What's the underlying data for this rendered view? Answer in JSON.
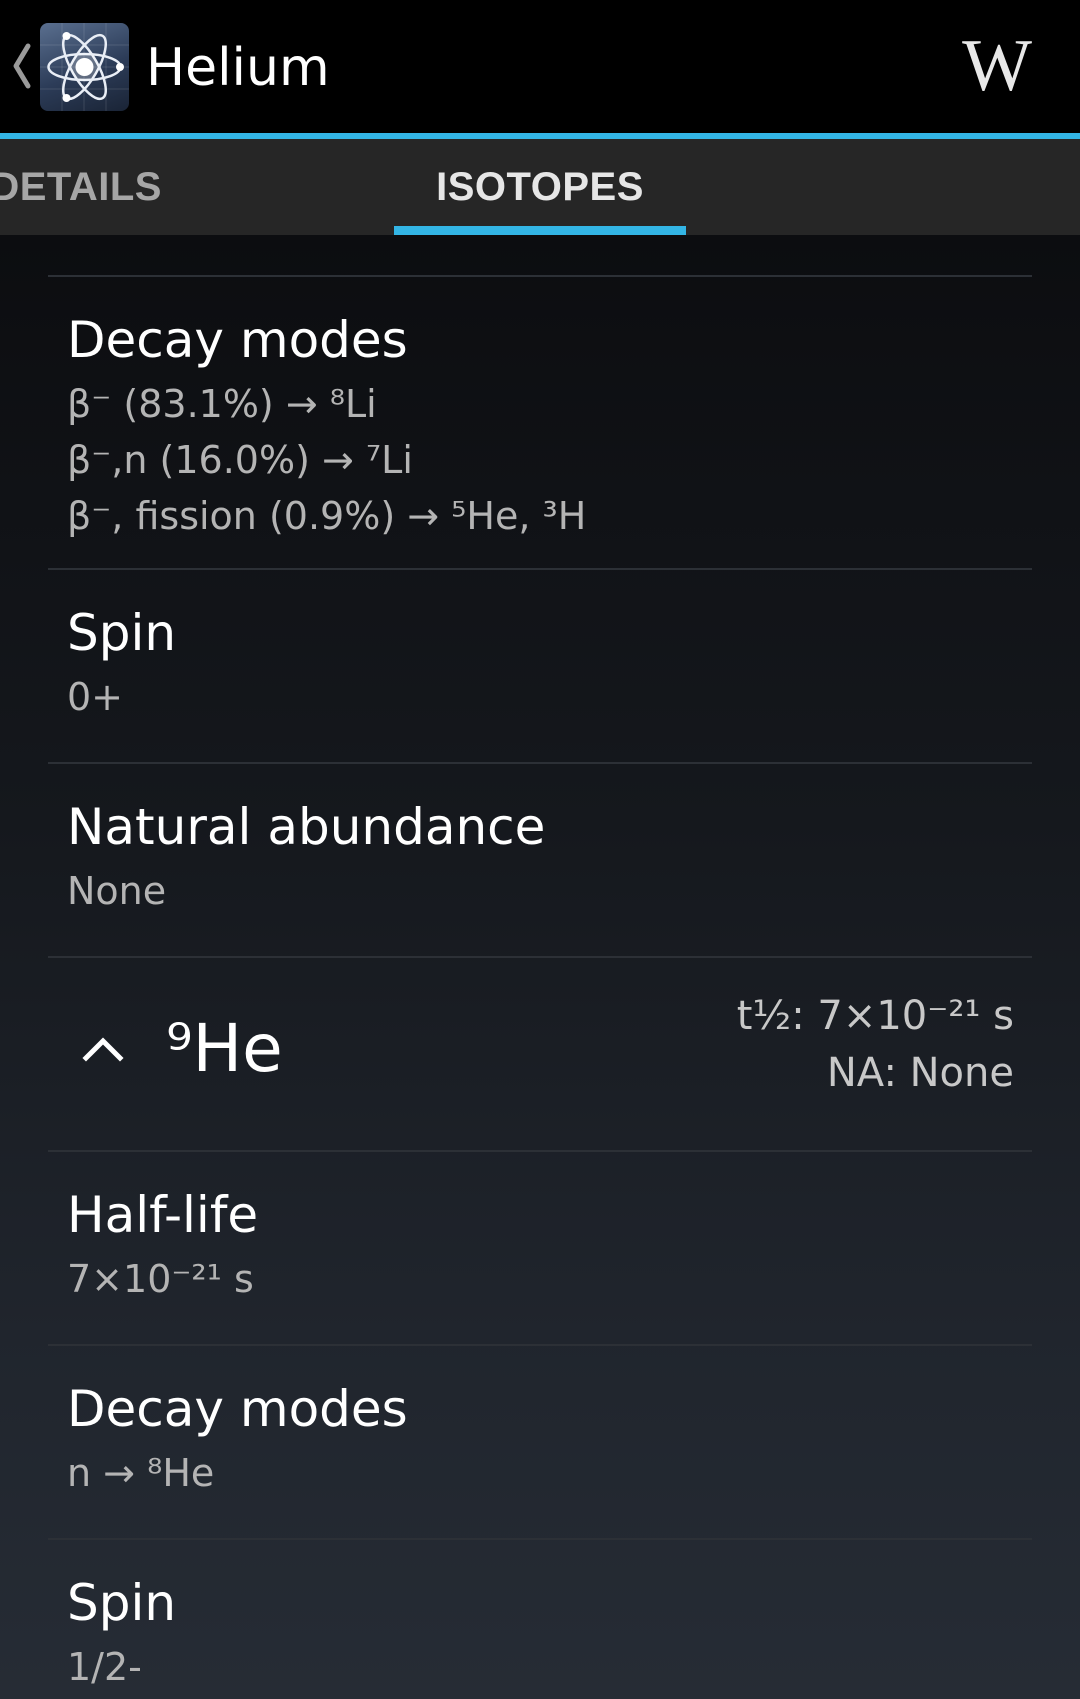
{
  "action_bar": {
    "title": "Helium",
    "up_caret": "‹",
    "app_icon": "atom-icon",
    "wikipedia_label": "W"
  },
  "tabs": [
    {
      "label": "DETAILS",
      "selected": false
    },
    {
      "label": "ISOTOPES",
      "selected": true
    }
  ],
  "colors": {
    "accent": "#33b5e5",
    "tab_bar": "#262626",
    "secondary_text": "#b4b4b4"
  },
  "isotope_8": {
    "decay_modes": {
      "label": "Decay modes",
      "lines": [
        "β⁻ (83.1%) → ⁸Li",
        "β⁻,n (16.0%) → ⁷Li",
        "β⁻, fission (0.9%) → ⁵He, ³H"
      ]
    },
    "spin": {
      "label": "Spin",
      "value": "0+"
    },
    "natural_abundance": {
      "label": "Natural abundance",
      "value": "None"
    }
  },
  "isotope_9": {
    "symbol": "⁹He",
    "half_life_summary": "t½: 7×10⁻²¹ s",
    "abundance_summary": "NA: None",
    "expanded": true,
    "half_life": {
      "label": "Half-life",
      "value": "7×10⁻²¹ s"
    },
    "decay_modes": {
      "label": "Decay modes",
      "lines": [
        "n → ⁸He"
      ]
    },
    "spin": {
      "label": "Spin",
      "value": "1/2-"
    }
  }
}
